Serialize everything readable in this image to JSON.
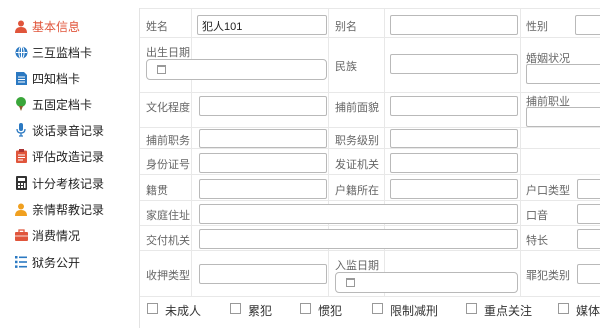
{
  "sidebar": {
    "items": [
      {
        "label": "基本信息",
        "icon": "person-icon",
        "color": "#e0553b"
      },
      {
        "label": "三互监档卡",
        "icon": "globe-icon",
        "color": "#2b79c2"
      },
      {
        "label": "四知档卡",
        "icon": "document-icon",
        "color": "#2b79c2"
      },
      {
        "label": "五固定档卡",
        "icon": "pin-icon",
        "color": "#3aa63a"
      },
      {
        "label": "谈话录音记录",
        "icon": "microphone-icon",
        "color": "#2b79c2"
      },
      {
        "label": "评估改造记录",
        "icon": "clipboard-icon",
        "color": "#e0553b"
      },
      {
        "label": "计分考核记录",
        "icon": "calculator-icon",
        "color": "#333333"
      },
      {
        "label": "亲情帮教记录",
        "icon": "user-icon",
        "color": "#f0a020"
      },
      {
        "label": "消费情况",
        "icon": "briefcase-icon",
        "color": "#e0553b"
      },
      {
        "label": "狱务公开",
        "icon": "list-icon",
        "color": "#2b79c2"
      }
    ]
  },
  "form": {
    "name_label": "姓名",
    "name_value": "犯人101",
    "alias_label": "别名",
    "gender_label": "性别",
    "birthdate_label": "出生日期",
    "ethnicity_label": "民族",
    "marital_label": "婚姻状况",
    "education_label": "文化程度",
    "political_label": "捕前面貌",
    "occupation_label": "捕前职业",
    "position_label": "捕前职务",
    "rank_label": "职务级别",
    "id_label": "身份证号",
    "issuer_label": "发证机关",
    "native_label": "籍贯",
    "household_label": "户籍所在",
    "household_type_label": "户口类型",
    "address_label": "家庭住址",
    "accent_label": "口音",
    "delivery_label": "交付机关",
    "specialty_label": "特长",
    "detention_type_label": "收押类型",
    "admission_date_label": "入监日期",
    "crime_type_label": "罪犯类别"
  },
  "checkboxes": [
    "未成人",
    "累犯",
    "惯犯",
    "限制减刑",
    "重点关注",
    "媒体"
  ]
}
